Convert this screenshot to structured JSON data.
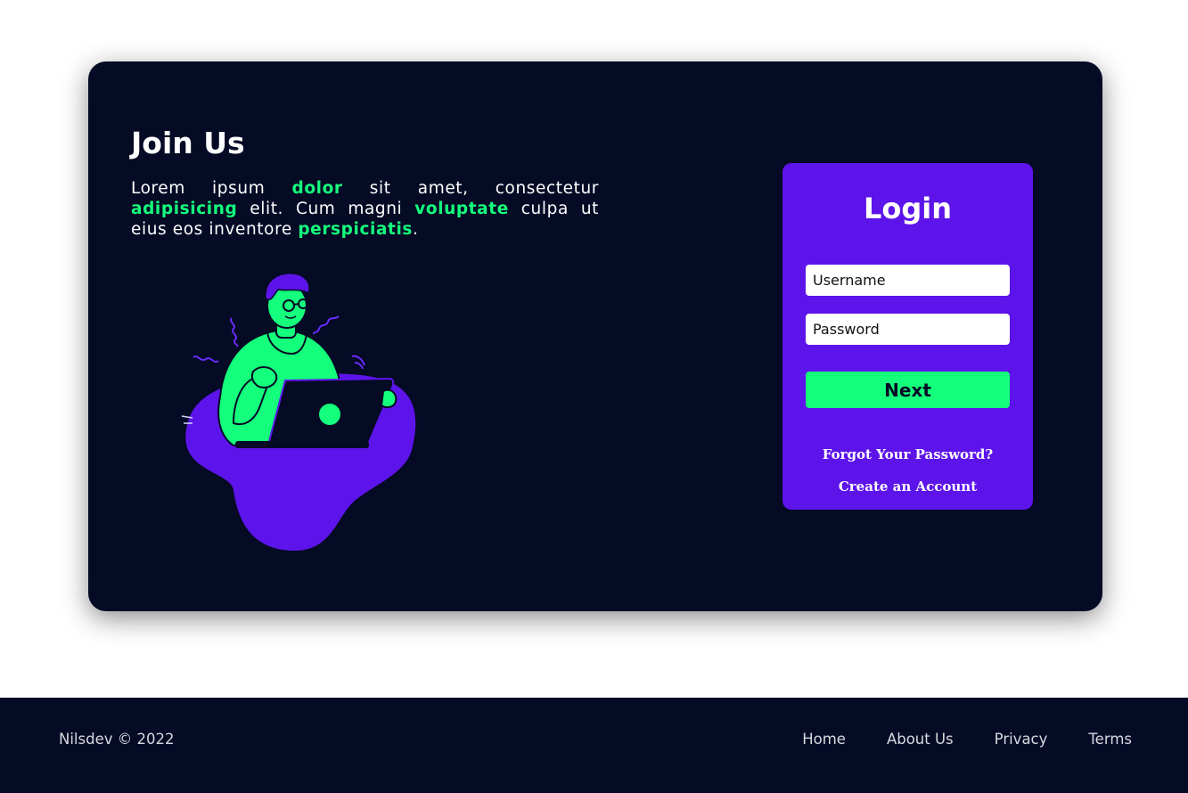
{
  "hero": {
    "title": "Join Us",
    "description": [
      {
        "text": "Lorem ipsum ",
        "highlight": false
      },
      {
        "text": "dolor",
        "highlight": true
      },
      {
        "text": " sit amet, consectetur ",
        "highlight": false
      },
      {
        "text": "adipisicing",
        "highlight": true
      },
      {
        "text": " elit. Cum magni ",
        "highlight": false
      },
      {
        "text": "voluptate",
        "highlight": true
      },
      {
        "text": " culpa ut eius eos inventore ",
        "highlight": false
      },
      {
        "text": "perspiciatis",
        "highlight": true
      },
      {
        "text": ".",
        "highlight": false
      }
    ],
    "illustration": "person-with-laptop-illustration"
  },
  "login": {
    "title": "Login",
    "username_placeholder": "Username",
    "password_placeholder": "Password",
    "next_label": "Next",
    "forgot_label": "Forgot Your Password?",
    "create_label": "Create an Account"
  },
  "footer": {
    "copyright": "Nilsdev © 2022",
    "nav": [
      "Home",
      "About Us",
      "Privacy",
      "Terms"
    ]
  },
  "colors": {
    "background_dark": "#050a25",
    "accent_purple": "#5d14ea",
    "accent_green": "#14ff7c"
  }
}
